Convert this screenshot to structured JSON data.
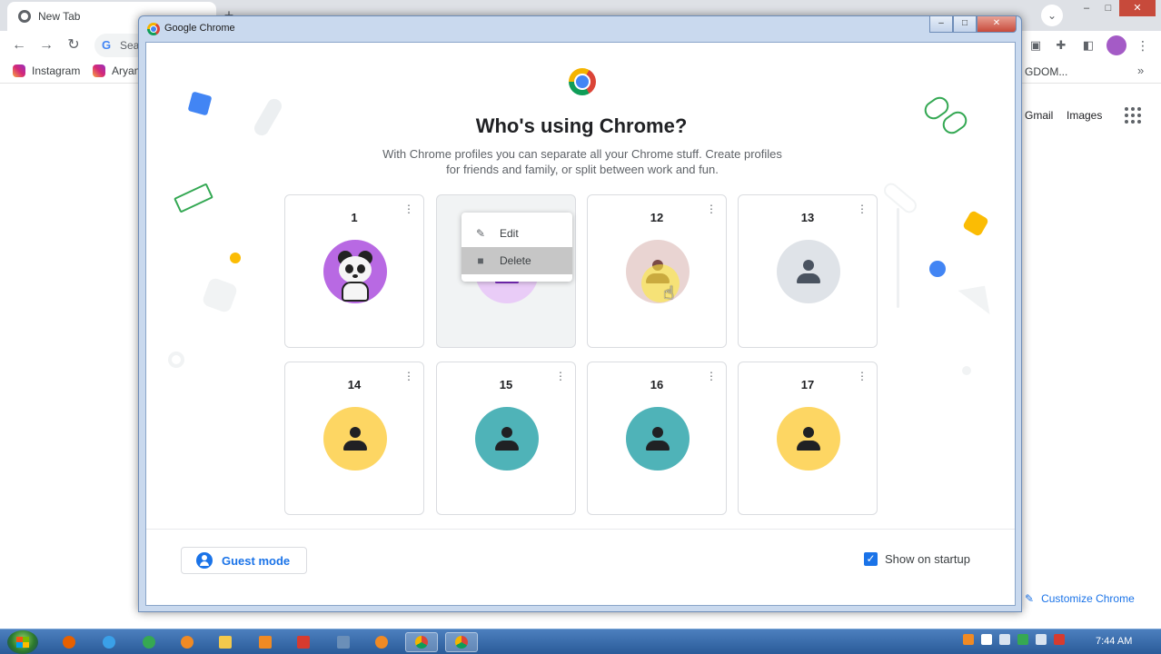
{
  "browser": {
    "tab_title": "New Tab",
    "omnibox_text": "Sea",
    "bookmarks": [
      "Instagram",
      "Aryan"
    ],
    "bookmark_right": "GDOM...",
    "links": {
      "gmail": "Gmail",
      "images": "Images"
    },
    "customize_label": "Customize Chrome"
  },
  "dialog": {
    "window_title": "Google Chrome",
    "heading": "Who's using Chrome?",
    "subheading": "With Chrome profiles you can separate all your Chrome stuff. Create profiles for friends and family, or split between work and fun.",
    "profiles": [
      {
        "name": "1",
        "avatar": "panda-avatar",
        "color": "#b869e3"
      },
      {
        "name": "",
        "avatar": "person-icon",
        "color": "#e9ccf7",
        "icon_color": "#7b2cbf",
        "menu_open": true
      },
      {
        "name": "12",
        "avatar": "person-icon",
        "color": "#e9d4d2",
        "icon_color": "#7a4a46"
      },
      {
        "name": "13",
        "avatar": "person-icon",
        "color": "#dfe3e8",
        "icon_color": "#4a5360"
      },
      {
        "name": "14",
        "avatar": "person-icon",
        "color": "#fdd663",
        "icon_color": "#202124"
      },
      {
        "name": "15",
        "avatar": "person-icon",
        "color": "#4fb3b8",
        "icon_color": "#202124"
      },
      {
        "name": "16",
        "avatar": "person-icon",
        "color": "#4fb3b8",
        "icon_color": "#202124"
      },
      {
        "name": "17",
        "avatar": "person-icon",
        "color": "#fdd663",
        "icon_color": "#202124"
      }
    ],
    "context_menu": {
      "edit": "Edit",
      "delete": "Delete"
    },
    "guest_mode": "Guest mode",
    "show_on_startup": "Show on startup",
    "show_on_startup_checked": true
  },
  "taskbar": {
    "clock": "7:44 AM"
  },
  "colors": {
    "accent": "#1a73e8"
  }
}
